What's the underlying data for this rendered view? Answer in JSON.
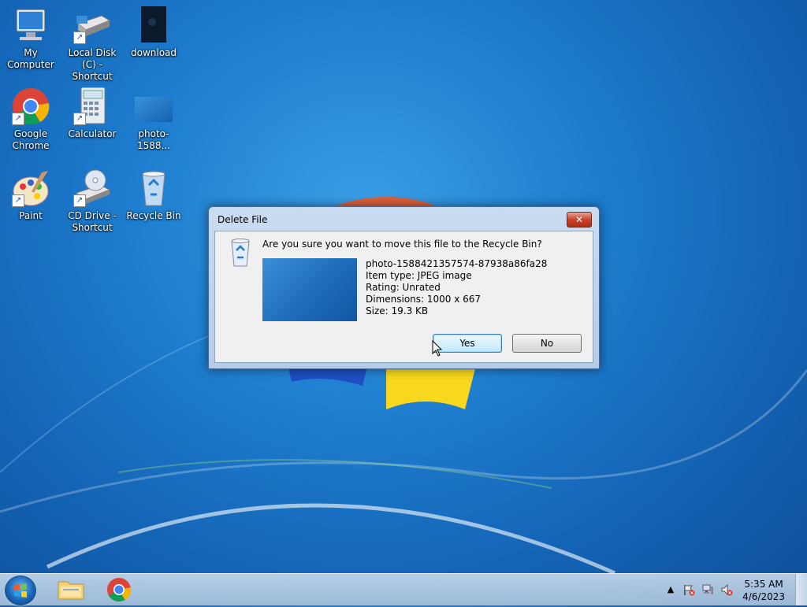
{
  "desktop": {
    "icons": [
      {
        "label": "My Computer",
        "icon": "computer-icon"
      },
      {
        "label": "Local Disk (C) - Shortcut",
        "icon": "drive-icon"
      },
      {
        "label": "download",
        "icon": "image-file-icon"
      },
      {
        "label": "Google Chrome",
        "icon": "chrome-icon"
      },
      {
        "label": "Calculator",
        "icon": "calculator-icon"
      },
      {
        "label": "photo-1588...",
        "icon": "image-file-icon"
      },
      {
        "label": "Paint",
        "icon": "paint-icon"
      },
      {
        "label": "CD Drive - Shortcut",
        "icon": "cd-drive-icon"
      },
      {
        "label": "Recycle Bin",
        "icon": "recycle-bin-icon"
      }
    ]
  },
  "dialog": {
    "title": "Delete File",
    "close_label": "✕",
    "question": "Are you sure you want to move this file to the Recycle Bin?",
    "file_name": "photo-1588421357574-87938a86fa28",
    "item_type": "Item type: JPEG image",
    "rating": "Rating: Unrated",
    "dimensions": "Dimensions: 1000 x 667",
    "size": "Size: 19.3 KB",
    "yes_label": "Yes",
    "no_label": "No"
  },
  "taskbar": {
    "time": "5:35 AM",
    "date": "4/6/2023",
    "tray_arrow": "▲"
  }
}
